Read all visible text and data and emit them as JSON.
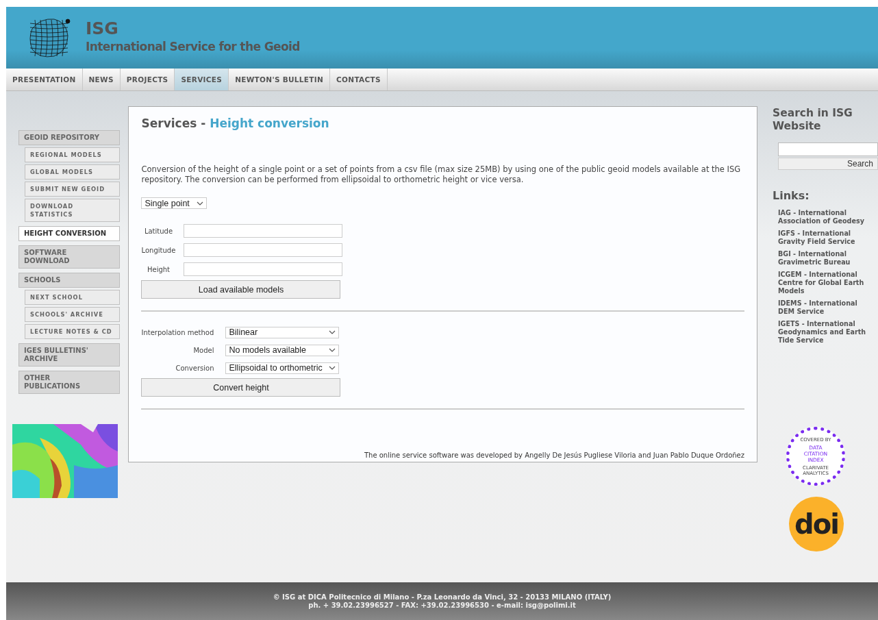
{
  "header": {
    "title": "ISG",
    "subtitle": "International Service for the Geoid"
  },
  "nav": [
    {
      "label": "PRESENTATION",
      "selected": false
    },
    {
      "label": "NEWS",
      "selected": false
    },
    {
      "label": "PROJECTS",
      "selected": false
    },
    {
      "label": "SERVICES",
      "selected": true
    },
    {
      "label": "NEWTON'S BULLETIN",
      "selected": false
    },
    {
      "label": "CONTACTS",
      "selected": false
    }
  ],
  "sidebar": {
    "items": [
      {
        "label": "GEOID REPOSITORY",
        "selected": false,
        "children": [
          {
            "label": "REGIONAL MODELS",
            "selected": false
          },
          {
            "label": "GLOBAL MODELS",
            "selected": false
          },
          {
            "label": "SUBMIT NEW GEOID",
            "selected": false
          },
          {
            "label": "DOWNLOAD STATISTICS",
            "selected": false
          }
        ]
      },
      {
        "label": "HEIGHT CONVERSION",
        "selected": true
      },
      {
        "label": "SOFTWARE DOWNLOAD",
        "selected": false
      },
      {
        "label": "SCHOOLS",
        "selected": false,
        "children": [
          {
            "label": "NEXT SCHOOL",
            "selected": false
          },
          {
            "label": "SCHOOLS' ARCHIVE",
            "selected": false
          },
          {
            "label": "LECTURE NOTES & CD",
            "selected": false
          }
        ]
      },
      {
        "label": "IGES BULLETINS' ARCHIVE",
        "selected": false
      },
      {
        "label": "OTHER PUBLICATIONS",
        "selected": false
      }
    ]
  },
  "content": {
    "title_prefix": "Services - ",
    "title": "Height conversion",
    "description": "Conversion of the height of a single point or a set of points from a csv file (max size 25MB) by using one of the public geoid models available at the ISG repository. The conversion can be performed from ellipsoidal to orthometric height or vice versa.",
    "mode_select": "Single point",
    "fields": [
      {
        "label": "Latitude"
      },
      {
        "label": "Longitude"
      },
      {
        "label": "Height"
      }
    ],
    "load_button": "Load available models",
    "selects": [
      {
        "label": "Interpolation method",
        "value": "Bilinear"
      },
      {
        "label": "Model",
        "value": "No models available"
      },
      {
        "label": "Conversion",
        "value": "Ellipsoidal to orthometric"
      }
    ],
    "convert_button": "Convert height",
    "credits": "The online service software was developed by Angelly De Jesús Pugliese Viloria and Juan Pablo Duque Ordoñez"
  },
  "right": {
    "search_title": "Search in ISG Website",
    "search_button": "Search",
    "links_title": "Links:",
    "links": [
      "IAG - International Association of Geodesy",
      "IGFS - International Gravity Field Service",
      "BGI - International Gravimetric Bureau",
      "ICGEM - International Centre for Global Earth Models",
      "IDEMS - International DEM Service",
      "IGETS - International Geodynamics and Earth Tide Service"
    ],
    "badge": {
      "top": "COVERED BY",
      "main": "DATA CITATION INDEX",
      "bottom": "CLARIVATE ANALYTICS"
    },
    "doi": "doi"
  },
  "footer": [
    "© ISG at DICA Politecnico di Milano - P.za Leonardo da Vinci, 32 - 20133 MILANO (ITALY)",
    "ph. + 39.02.23996527 - FAX: +39.02.23996530 - e-mail: isg@polimi.it"
  ]
}
